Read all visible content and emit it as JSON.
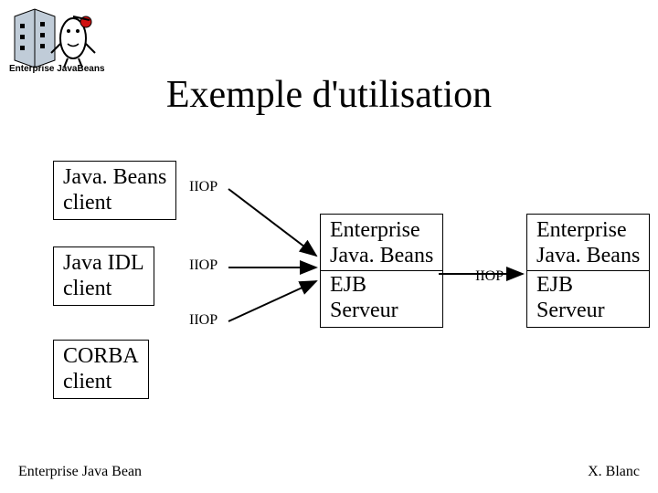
{
  "title": "Exemple d'utilisation",
  "logo": {
    "caption": "Enterprise JavaBeans"
  },
  "clients": [
    {
      "line1": "Java. Beans",
      "line2": "client"
    },
    {
      "line1": "Java IDL",
      "line2": "client"
    },
    {
      "line1": "CORBA",
      "line2": "client"
    }
  ],
  "protocol": "IIOP",
  "servers": [
    {
      "line1": "Enterprise",
      "line2": "Java. Beans",
      "line3": "EJB",
      "line4": "Serveur"
    },
    {
      "line1": "Enterprise",
      "line2": "Java. Beans",
      "line3": "EJB",
      "line4": "Serveur"
    }
  ],
  "footer": {
    "left": "Enterprise Java Bean",
    "right": "X. Blanc"
  }
}
